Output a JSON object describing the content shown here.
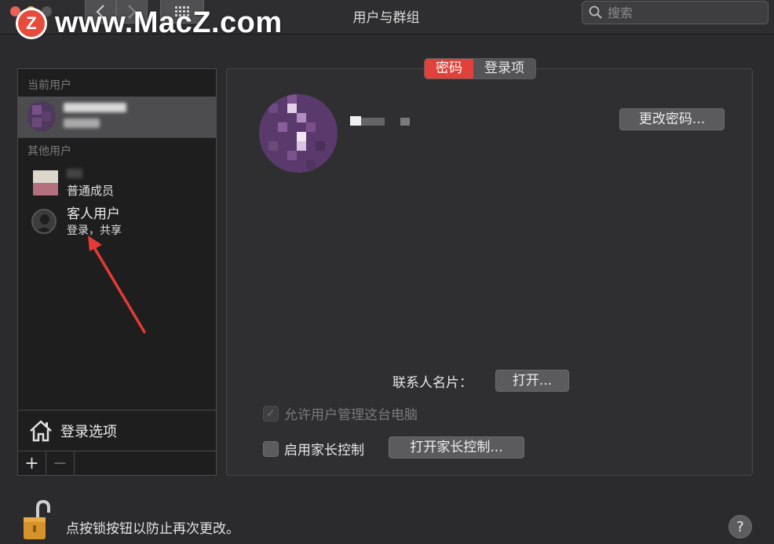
{
  "window": {
    "title": "用户与群组"
  },
  "toolbar": {
    "back_icon": "chevron-left-icon",
    "forward_icon": "chevron-right-icon",
    "grid_icon": "grid-icon",
    "search_placeholder": "搜索"
  },
  "watermark": {
    "logo_letter": "Z",
    "text": "www.MacZ.com"
  },
  "users": {
    "current_label": "当前用户",
    "other_label": "其他用户",
    "member_role": "普通成员",
    "guest_name": "客人用户",
    "guest_sub": "登录，共享",
    "login_options": "登录选项",
    "add_label": "+",
    "remove_label": "−"
  },
  "tabs": [
    {
      "label": "密码",
      "active": true
    },
    {
      "label": "登录项",
      "active": false
    }
  ],
  "detail": {
    "change_password": "更改密码...",
    "contact_card_label": "联系人名片：",
    "open_button": "打开...",
    "allow_admin": "允许用户管理这台电脑",
    "allow_admin_checked": true,
    "allow_admin_enabled": false,
    "parental_label": "启用家长控制",
    "parental_checked": false,
    "open_parental": "打开家长控制..."
  },
  "footer": {
    "lock_text": "点按锁按钮以防止再次更改。",
    "help": "?"
  },
  "colors": {
    "accent": "#e0413a",
    "background": "#2b2b2d"
  }
}
